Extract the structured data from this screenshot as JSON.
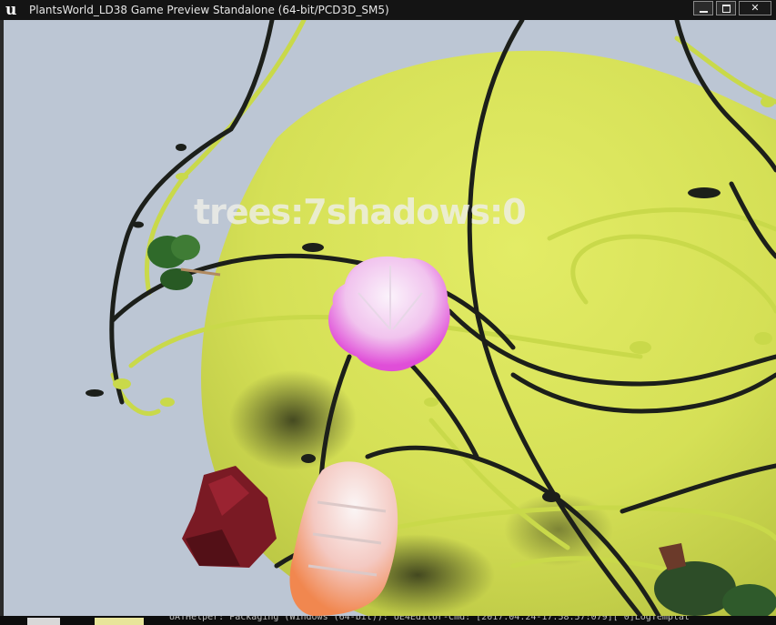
{
  "window": {
    "title": "PlantsWorld_LD38 Game Preview Standalone (64-bit/PCD3D_SM5)",
    "logo_icon": "unreal-engine-icon",
    "controls": [
      "minimize-icon",
      "maximize-icon",
      "close-icon"
    ]
  },
  "hud": {
    "stats_text": "trees:7shadows:0"
  },
  "taskbar": {
    "log_text": "UATHelper: Packaging (Windows (64-bit)): UE4Editor-Cmd: [2017.04.24-17.58.57:079][ 0]LogTemplat"
  },
  "colors": {
    "sky": "#bcc6d4",
    "planet": "#d8e35a",
    "vine_dark": "#1c1f1a",
    "vine_light": "#c9d94a",
    "flower_pink": "#f2b6ef",
    "flower_peach": "#f3a78c",
    "leaf_green": "#2f6a2a",
    "rock_red": "#7a1a24"
  }
}
